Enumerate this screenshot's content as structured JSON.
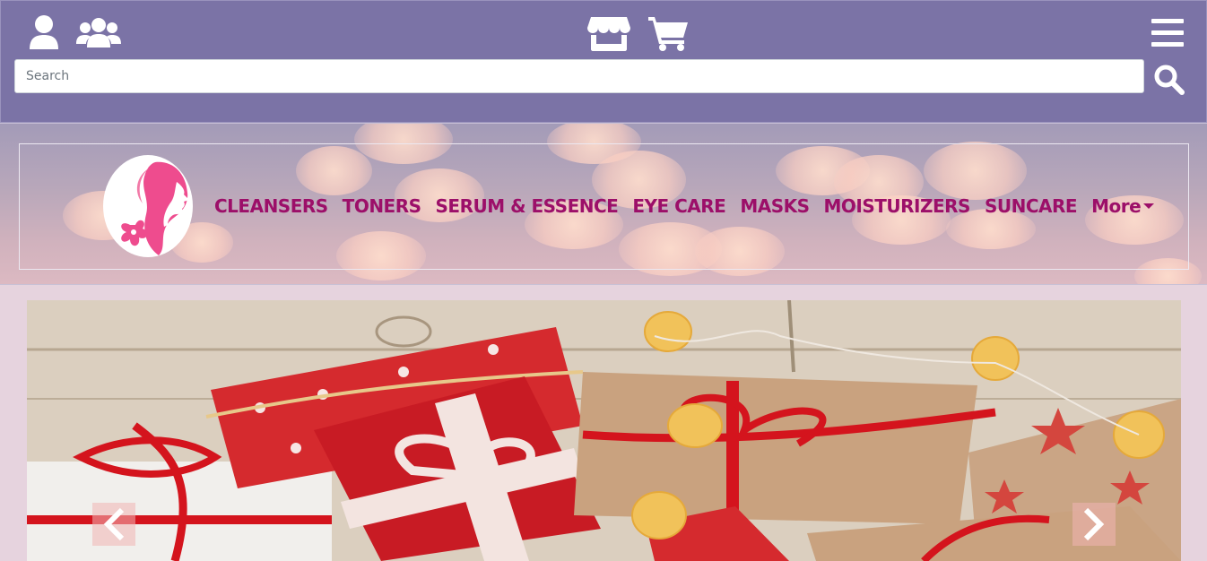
{
  "header": {
    "icons": [
      "user-icon",
      "users-icon",
      "store-icon",
      "cart-icon",
      "menu-icon"
    ],
    "search": {
      "placeholder": "Search",
      "value": "",
      "button_icon": "search-icon"
    },
    "colors": {
      "bar": "#7b73a6",
      "icon": "#ffffff"
    }
  },
  "nav": {
    "logo_icon": "face-logo-icon",
    "links": [
      "CLEANSERS",
      "TONERS",
      "SERUM & ESSENCE",
      "EYE CARE",
      "MASKS",
      "MOISTURIZERS",
      "SUNCARE"
    ],
    "more_label": "More",
    "colors": {
      "link": "#9c0f69"
    }
  },
  "carousel": {
    "prev_icon": "chevron-left-icon",
    "next_icon": "chevron-right-icon",
    "slide": "christmas-gifts-image"
  }
}
